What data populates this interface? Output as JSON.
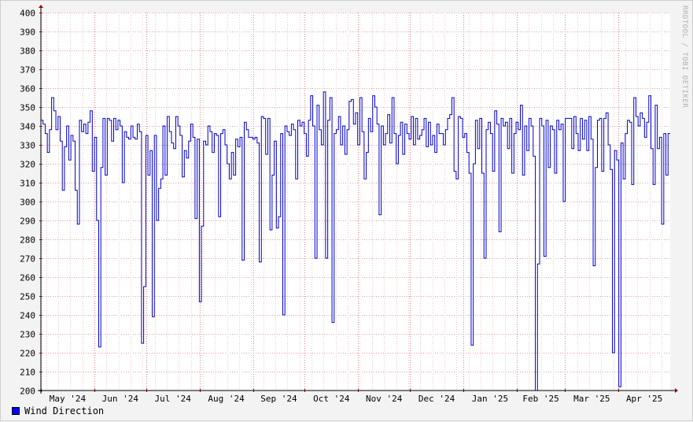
{
  "chart_data": {
    "type": "line",
    "legend": [
      {
        "name": "Wind Direction",
        "color": "#0000ff"
      }
    ],
    "x_ticks": [
      "May '24",
      "Jun '24",
      "Jul '24",
      "Aug '24",
      "Sep '24",
      "Oct '24",
      "Nov '24",
      "Dec '24",
      "Jan '25",
      "Feb '25",
      "Mar '25",
      "Apr '25"
    ],
    "ylim": [
      200,
      400
    ],
    "y_ticks": [
      200,
      210,
      220,
      230,
      240,
      250,
      260,
      270,
      280,
      290,
      300,
      310,
      320,
      330,
      340,
      350,
      360,
      370,
      380,
      390,
      400
    ],
    "grid": true,
    "series": [
      {
        "name": "Wind Direction",
        "color": "#0000ff",
        "values": [
          343,
          341,
          336,
          326,
          338,
          355,
          348,
          338,
          345,
          332,
          306,
          329,
          340,
          322,
          335,
          332,
          306,
          288,
          343,
          337,
          341,
          336,
          342,
          348,
          316,
          334,
          290,
          223,
          318,
          344,
          314,
          344,
          343,
          332,
          344,
          338,
          343,
          340,
          310,
          337,
          334,
          333,
          340,
          334,
          333,
          341,
          337,
          225,
          255,
          335,
          314,
          327,
          239,
          335,
          290,
          307,
          312,
          340,
          314,
          345,
          337,
          331,
          328,
          345,
          340,
          335,
          313,
          327,
          323,
          332,
          341,
          334,
          291,
          333,
          247,
          287,
          332,
          330,
          340,
          337,
          326,
          336,
          335,
          292,
          336,
          338,
          330,
          320,
          312,
          326,
          314,
          333,
          329,
          334,
          269,
          342,
          338,
          334,
          334,
          333,
          334,
          331,
          268,
          345,
          344,
          325,
          344,
          285,
          314,
          332,
          286,
          292,
          336,
          240,
          340,
          337,
          335,
          341,
          338,
          312,
          343,
          340,
          342,
          336,
          324,
          343,
          356,
          340,
          270,
          351,
          338,
          330,
          358,
          270,
          343,
          355,
          236,
          336,
          338,
          345,
          330,
          340,
          325,
          338,
          353,
          354,
          341,
          347,
          330,
          355,
          337,
          312,
          326,
          344,
          337,
          356,
          350,
          341,
          293,
          340,
          330,
          336,
          346,
          331,
          355,
          336,
          320,
          335,
          342,
          325,
          341,
          336,
          333,
          345,
          330,
          344,
          333,
          335,
          338,
          344,
          329,
          342,
          330,
          335,
          326,
          341,
          336,
          336,
          330,
          338,
          344,
          346,
          355,
          316,
          312,
          345,
          344,
          334,
          336,
          326,
          315,
          224,
          320,
          343,
          328,
          344,
          315,
          270,
          338,
          342,
          336,
          316,
          348,
          341,
          284,
          344,
          340,
          342,
          328,
          344,
          315,
          336,
          342,
          338,
          351,
          314,
          340,
          327,
          344,
          340,
          324,
          200,
          267,
          344,
          340,
          271,
          343,
          318,
          340,
          338,
          315,
          343,
          338,
          341,
          300,
          344,
          344,
          344,
          328,
          345,
          336,
          327,
          344,
          333,
          343,
          327,
          345,
          333,
          266,
          318,
          343,
          344,
          316,
          344,
          347,
          330,
          317,
          220,
          327,
          322,
          202,
          331,
          312,
          336,
          343,
          342,
          309,
          355,
          345,
          340,
          347,
          344,
          334,
          342,
          356,
          328,
          309,
          351,
          328,
          334,
          288,
          336,
          314,
          336
        ]
      }
    ]
  },
  "watermark": "RRDTOOL / TOBI OETIKER"
}
